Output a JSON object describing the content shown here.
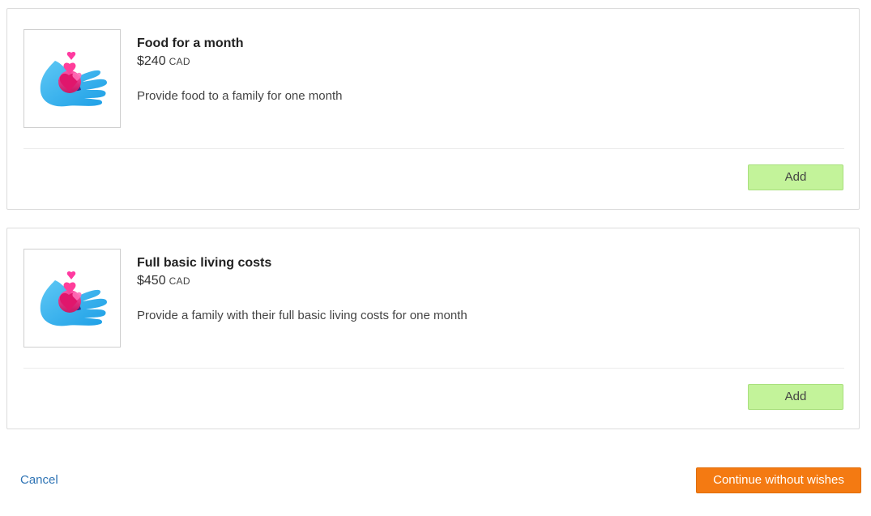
{
  "wishes": [
    {
      "icon": "hand-hearts-icon",
      "title": "Food for a month",
      "price": "$240",
      "currency": "CAD",
      "description": "Provide food to a family for one month",
      "add_label": "Add"
    },
    {
      "icon": "hand-hearts-icon",
      "title": "Full basic living costs",
      "price": "$450",
      "currency": "CAD",
      "description": "Provide a family with their full basic living costs for one month",
      "add_label": "Add"
    }
  ],
  "footer": {
    "cancel_label": "Cancel",
    "continue_label": "Continue without wishes"
  },
  "colors": {
    "add_button": "#c3f39a",
    "continue_button": "#f47a12",
    "link": "#2f74b5"
  }
}
